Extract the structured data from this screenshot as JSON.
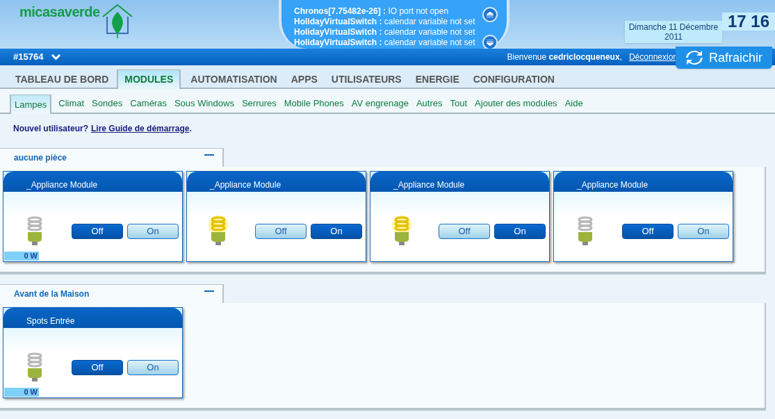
{
  "logo": {
    "text": "micasaverde"
  },
  "notifications": [
    "**Chronos[7.75482e-26] :** IO port not open",
    "**HolidayVirtualSwitch :** calendar variable not set",
    "**HolidayVirtualSwitch :** calendar variable not set",
    "**HolidayVirtualSwitch :** calendar variable not set"
  ],
  "date": "Dimanche 11 Décembre 2011",
  "time": "17 16",
  "account": "#15764",
  "welcome": "Bienvenue **cedriclocqueneux**,",
  "logout": "Déconnexion",
  "refresh": "Rafraichir",
  "tabs": [
    {
      "label": "TABLEAU DE BORD",
      "selected": false
    },
    {
      "label": "MODULES",
      "selected": true
    },
    {
      "label": "AUTOMATISATION",
      "selected": false
    },
    {
      "label": "APPS",
      "selected": false
    },
    {
      "label": "UTILISATEURS",
      "selected": false
    },
    {
      "label": "ENERGIE",
      "selected": false
    },
    {
      "label": "CONFIGURATION",
      "selected": false
    }
  ],
  "subtabs": [
    {
      "label": "Lampes",
      "selected": true
    },
    {
      "label": "Climat",
      "selected": false
    },
    {
      "label": "Sondes",
      "selected": false
    },
    {
      "label": "Caméras",
      "selected": false
    },
    {
      "label": "Sous Windows",
      "selected": false
    },
    {
      "label": "Serrures",
      "selected": false
    },
    {
      "label": "Mobile Phones",
      "selected": false
    },
    {
      "label": "AV engrenage",
      "selected": false
    },
    {
      "label": "Autres",
      "selected": false
    },
    {
      "label": "Tout",
      "selected": false
    },
    {
      "label": "Ajouter des modules",
      "selected": false
    },
    {
      "label": "Aide",
      "selected": false
    }
  ],
  "notice": {
    "text": "Nouvel utilisateur?",
    "link": "Lire Guide de démarrage",
    "end": "."
  },
  "rooms": [
    {
      "name": "aucune pièce",
      "devices": [
        {
          "name": "_Appliance Module",
          "lit": false,
          "power": "0 W",
          "buttons": [
            {
              "label": "Off",
              "selected": true
            },
            {
              "label": "On",
              "selected": false
            }
          ]
        },
        {
          "name": "_Appliance Module",
          "lit": true,
          "buttons": [
            {
              "label": "Off",
              "selected": false
            },
            {
              "label": "On",
              "selected": true
            }
          ]
        },
        {
          "name": "_Appliance Module",
          "lit": true,
          "buttons": [
            {
              "label": "Off",
              "selected": false
            },
            {
              "label": "On",
              "selected": true
            }
          ]
        },
        {
          "name": "_Appliance Module",
          "lit": false,
          "buttons": [
            {
              "label": "Off",
              "selected": true
            },
            {
              "label": "On",
              "selected": false
            }
          ]
        }
      ]
    },
    {
      "name": "Avant de la Maison",
      "devices": [
        {
          "name": "Spots Entrée",
          "lit": false,
          "power": "0 W",
          "buttons": [
            {
              "label": "Off",
              "selected": true
            },
            {
              "label": "On",
              "selected": false
            }
          ]
        }
      ]
    }
  ]
}
